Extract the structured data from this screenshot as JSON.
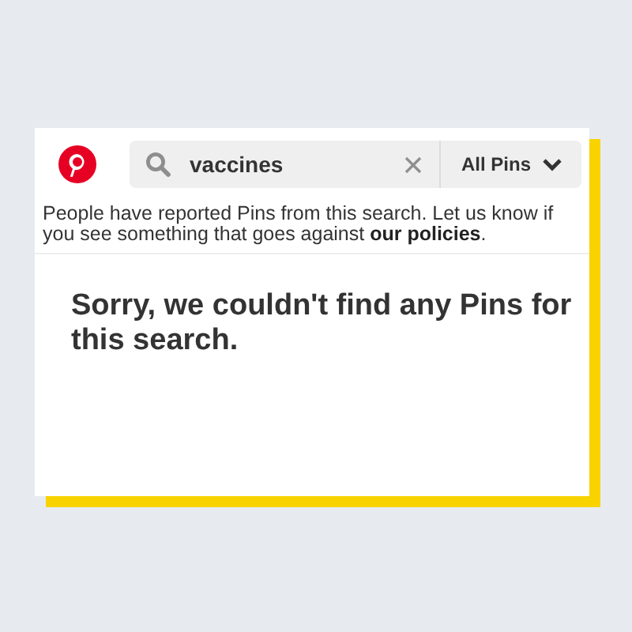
{
  "search": {
    "value": "vaccines",
    "filter": "All Pins"
  },
  "notice": "People have reported Pins from this search. Let us know if you see something that goes against **our policies**.",
  "message": "Sorry, we couldn't find any Pins for this search."
}
